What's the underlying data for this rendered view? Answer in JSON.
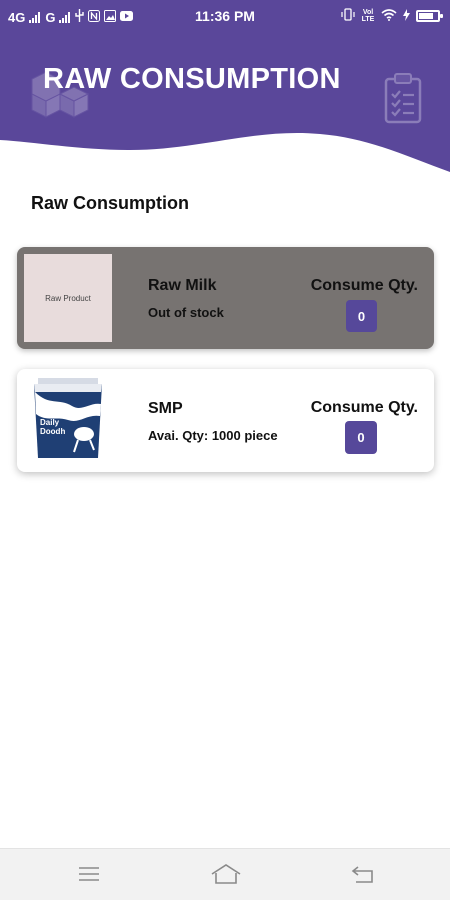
{
  "status_bar": {
    "network_1": "4G",
    "network_2": "G",
    "time": "11:36 PM",
    "volte_label": "Vol LTE"
  },
  "header": {
    "title": "RAW CONSUMPTION",
    "background_color": "#5a479a",
    "left_icon": "cubes-icon",
    "right_icon": "clipboard-list-icon"
  },
  "section_title": "Raw Consumption",
  "products": [
    {
      "name": "Raw Milk",
      "stock_text": "Out of stock",
      "image_placeholder": "Raw Product",
      "qty_label": "Consume Qty.",
      "qty_value": "0",
      "state": "disabled"
    },
    {
      "name": "SMP",
      "stock_text": "Avai. Qty: 1000 piece",
      "image": "daily-doodh-packet",
      "pack_text": "Daily Doodh",
      "qty_label": "Consume Qty.",
      "qty_value": "0",
      "state": "active"
    }
  ],
  "nav_bar": {
    "icons": [
      "menu-icon",
      "home-icon",
      "back-icon"
    ]
  },
  "colors": {
    "accent": "#56489a",
    "disabled_card": "#777371"
  }
}
